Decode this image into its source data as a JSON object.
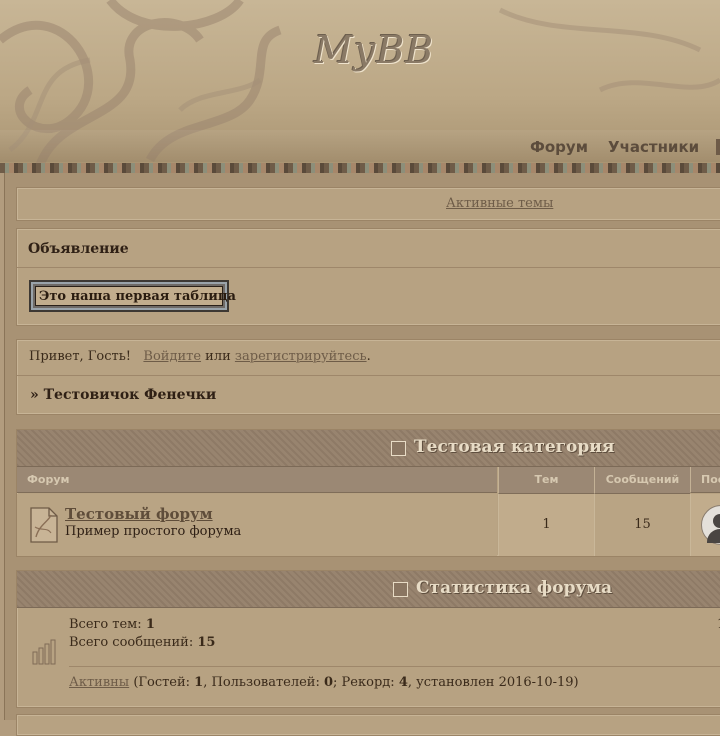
{
  "header": {
    "logo_text": "MyBB",
    "nav": [
      "Форум",
      "Участники"
    ]
  },
  "active_threads_link": "Активные темы",
  "announcement": {
    "title": "Объявление",
    "button_label": "Это наша первая таблица"
  },
  "welcome": {
    "greeting": "Привет, Гость!",
    "login_link": "Войдите",
    "or_text": "или",
    "register_link": "зарегистрируйтесь",
    "period": ".",
    "breadcrumb": "» Тестовичок Фенечки"
  },
  "category": {
    "title": "Тестовая категория",
    "columns": [
      "Форум",
      "Тем",
      "Сообщений",
      "Пос"
    ],
    "forums": [
      {
        "name": "Тестовый форум",
        "description": "Пример простого форума",
        "topics": "1",
        "posts": "15"
      }
    ]
  },
  "stats": {
    "title": "Статистика форума",
    "total_topics_label": "Всего тем:",
    "total_topics": "1",
    "total_posts_label": "Всего сообщений:",
    "total_posts": "15",
    "right_edge_char": "1",
    "active_link": "Активны",
    "guests_label": "(Гостей:",
    "guests": "1",
    "users_label": ", Пользователей:",
    "users": "0",
    "record_label": "; Рекорд:",
    "record": "4",
    "set_label": ", установлен",
    "record_date": "2016-10-19)"
  },
  "colors": {
    "page_bg": "#b29c7e",
    "box_bg": "#b7a282",
    "category_header": "#8e7a66",
    "text_dark": "#3a2a1a",
    "link": "#6e5c48"
  }
}
